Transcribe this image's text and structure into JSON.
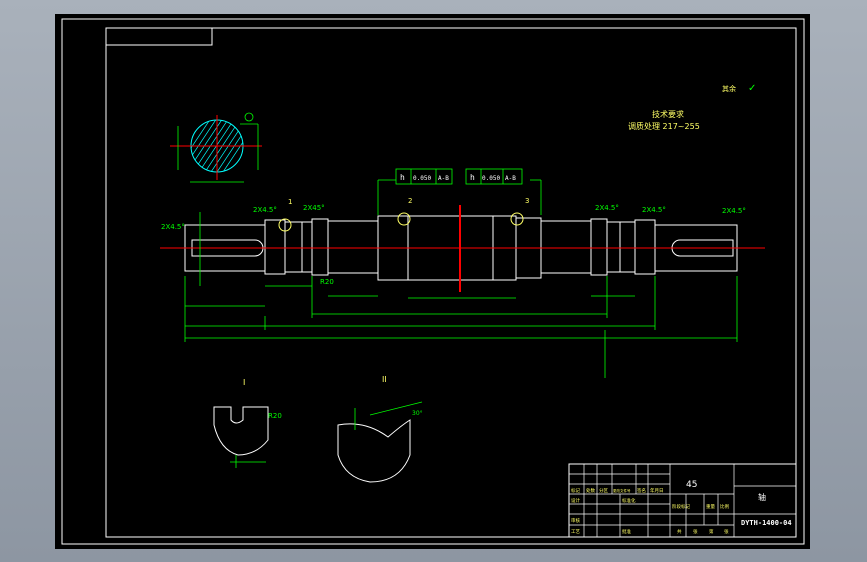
{
  "drawing": {
    "hardness_note": "调质处理 217~255",
    "surface_finish_label": "其余",
    "surface_finish_symbol": "✓",
    "tech_req_title": "技术要求",
    "section_labels": [
      "I",
      "II"
    ],
    "chamfers": [
      "2X4.5°",
      "2X4.5°",
      "2X45°",
      "2X4.5°",
      "2X4.5°",
      "2X4.5°"
    ],
    "fillet": "R20",
    "fillet_detail_i": "R20",
    "angle_detail_ii": "30°",
    "tolerance_frames": [
      {
        "sym": "h",
        "value": "0.050",
        "datum": "A-B"
      },
      {
        "sym": "h",
        "value": "0.050",
        "datum": "A-B"
      }
    ],
    "balloons": [
      "1",
      "2",
      "3",
      "1"
    ]
  },
  "title_block": {
    "material": "45",
    "part_name": "轴",
    "drawing_number": "DYTH-1400-04",
    "sub_labels": [
      "标记",
      "处数",
      "分区",
      "更改文件号",
      "签名",
      "年月日"
    ],
    "approval_labels": [
      "设计",
      "标准化",
      "审核",
      "工艺",
      "批准"
    ],
    "stage_labels": [
      "阶段标记",
      "重量",
      "比例"
    ],
    "sheet_labels": [
      "共",
      "张",
      "第",
      "张"
    ]
  },
  "colors": {
    "background": "#000000",
    "frame": "#ffffff",
    "dimension": "#00ff00",
    "centerline": "#ff0000",
    "annotation": "#00ffff",
    "text": "#ffff66"
  }
}
